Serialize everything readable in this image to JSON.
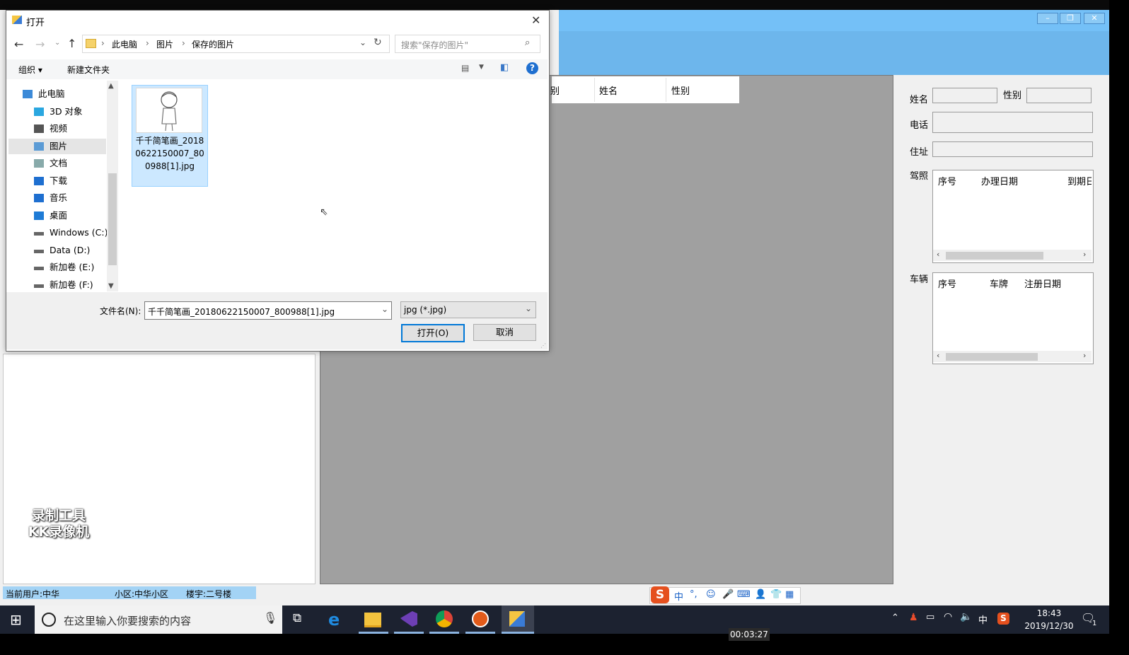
{
  "dialog": {
    "title": "打开",
    "close": "✕",
    "breadcrumb": [
      "此电脑",
      "图片",
      "保存的图片"
    ],
    "search_placeholder": "搜索\"保存的图片\"",
    "organize": "组织 ▾",
    "new_folder": "新建文件夹",
    "help": "?",
    "nav_items": [
      {
        "label": "此电脑",
        "icon": "pc-icon"
      },
      {
        "label": "3D 对象",
        "icon": "cube-icon"
      },
      {
        "label": "视频",
        "icon": "video-icon"
      },
      {
        "label": "图片",
        "icon": "pictures-icon"
      },
      {
        "label": "文档",
        "icon": "document-icon"
      },
      {
        "label": "下载",
        "icon": "download-icon"
      },
      {
        "label": "音乐",
        "icon": "music-icon"
      },
      {
        "label": "桌面",
        "icon": "desktop-icon"
      },
      {
        "label": "Windows (C:)",
        "icon": "drive-icon"
      },
      {
        "label": "Data (D:)",
        "icon": "drive-icon"
      },
      {
        "label": "新加卷 (E:)",
        "icon": "drive-icon"
      },
      {
        "label": "新加卷 (F:)",
        "icon": "drive-icon"
      }
    ],
    "file": {
      "name": "千千简笔画_20180622150007_800988[1].jpg"
    },
    "filename_label": "文件名(N):",
    "filename_value": "千千简笔画_20180622150007_800988[1].jpg",
    "filetype": "jpg (*.jpg)",
    "open_button": "打开(O)",
    "cancel_button": "取消"
  },
  "app": {
    "grid_columns": [
      "别",
      "姓名",
      "性别"
    ],
    "form": {
      "name_label": "姓名",
      "gender_label": "性别",
      "phone_label": "电话",
      "address_label": "住址",
      "license_label": "驾照",
      "license_columns": [
        "序号",
        "办理日期",
        "到期日"
      ],
      "vehicle_label": "车辆",
      "vehicle_columns": [
        "序号",
        "车牌",
        "注册日期"
      ]
    },
    "status": {
      "user": "当前用户:中华",
      "district": "小区:中华小区",
      "building": "楼宇:二号楼"
    },
    "watermark": [
      "录制工具",
      "KK录像机"
    ]
  },
  "ime": {
    "lang": "中",
    "punct": "°,"
  },
  "taskbar": {
    "search_placeholder": "在这里输入你要搜索的内容",
    "time": "18:43",
    "date": "2019/12/30",
    "tray_lang": "中",
    "notification_count": "1"
  },
  "recording_timer": "00:03:27",
  "colors": {
    "accent": "#0078d7",
    "titlebar_blue": "#74c0f7",
    "selection": "#cce8ff",
    "taskbar": "#1c2230"
  }
}
